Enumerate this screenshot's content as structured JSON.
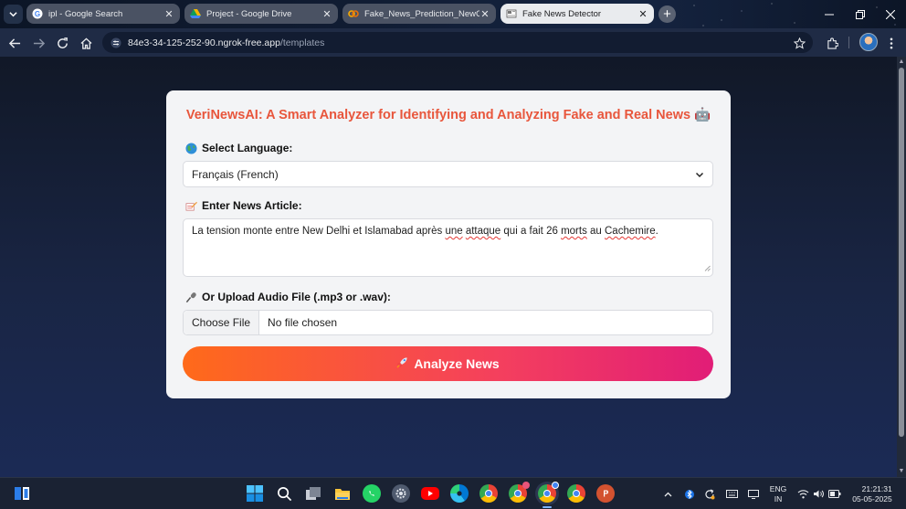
{
  "browser": {
    "tabs": [
      {
        "title": "ipl - Google Search",
        "favicon": "google-icon",
        "active": false
      },
      {
        "title": "Project - Google Drive",
        "favicon": "google-drive-icon",
        "active": false
      },
      {
        "title": "Fake_News_Prediction_NewC",
        "favicon": "colab-icon",
        "active": false
      },
      {
        "title": "Fake News Detector",
        "favicon": "newspaper-icon",
        "active": true
      }
    ],
    "address": {
      "host": "84e3-34-125-252-90.ngrok-free.app",
      "path": "/templates"
    }
  },
  "app": {
    "title": "VeriNewsAI: A Smart Analyzer for Identifying and Analyzing Fake and Real News 🤖",
    "language_label": "Select Language:",
    "language_value": "Français (French)",
    "article_label": "Enter News Article:",
    "article_text": {
      "t1": "La tension monte entre New Delhi et Islamabad après ",
      "w1": "une",
      "t2": " ",
      "w2": "attaque",
      "t3": " qui a fait 26 ",
      "w3": "morts",
      "t4": " au ",
      "w4": "Cachemire",
      "t5": "."
    },
    "audio_label": "Or Upload Audio File (.mp3 or .wav):",
    "file_button": "Choose File",
    "file_status": "No file chosen",
    "analyze_label": "Analyze News",
    "colors": {
      "title": "#e8563c",
      "button_start": "#ff6a1a",
      "button_end": "#e11d77"
    }
  },
  "taskbar": {
    "language": "ENG",
    "region": "IN",
    "time": "21:21:31",
    "date": "05-05-2025",
    "icons": [
      "windows-start-icon",
      "search-icon",
      "task-view-icon",
      "file-explorer-icon",
      "whatsapp-icon",
      "settings-icon",
      "youtube-icon",
      "edge-icon",
      "chrome-icon",
      "chrome-profile-icon",
      "chrome-active-icon",
      "chrome-icon",
      "powerpoint-icon"
    ]
  }
}
